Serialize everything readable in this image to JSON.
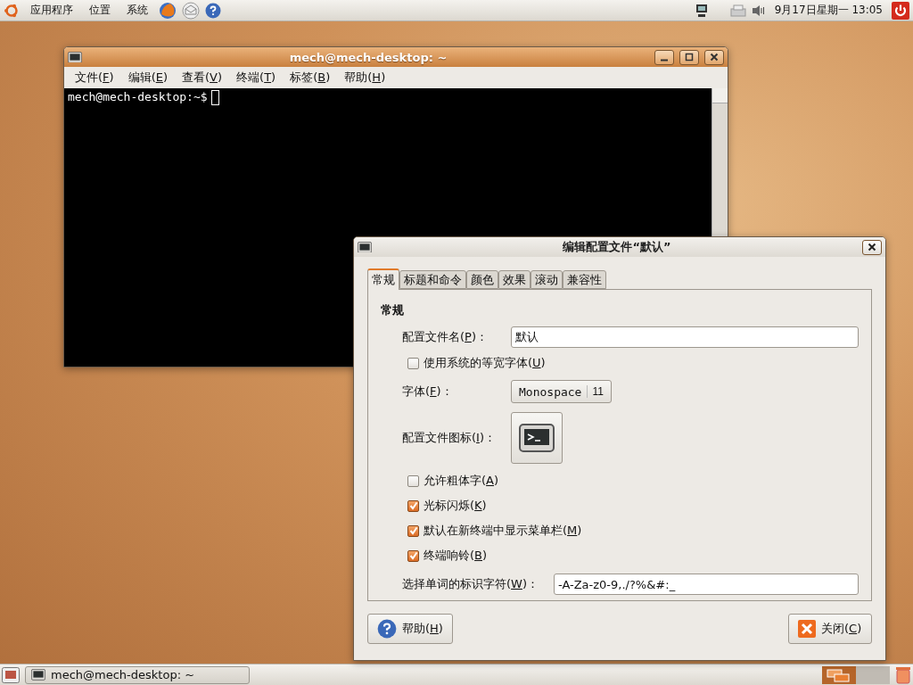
{
  "top_panel": {
    "menus": [
      "应用程序",
      "位置",
      "系统"
    ],
    "clock": "9月17日星期一 13:05"
  },
  "terminal": {
    "title": "mech@mech-desktop: ~",
    "menus": [
      "文件(F)",
      "编辑(E)",
      "查看(V)",
      "终端(T)",
      "标签(B)",
      "帮助(H)"
    ],
    "prompt": "mech@mech-desktop:~$"
  },
  "dialog": {
    "title": "编辑配置文件“默认”",
    "tabs": [
      {
        "label": "常规",
        "selected": true
      },
      {
        "label": "标题和命令",
        "selected": false
      },
      {
        "label": "颜色",
        "selected": false
      },
      {
        "label": "效果",
        "selected": false
      },
      {
        "label": "滚动",
        "selected": false
      },
      {
        "label": "兼容性",
        "selected": false
      }
    ],
    "section": "常规",
    "rows": [
      {
        "kind": "text",
        "label": "配置文件名(P)：",
        "value": "默认"
      },
      {
        "kind": "checkbox",
        "label": "使用系统的等宽字体(U)",
        "checked": false
      },
      {
        "kind": "font",
        "label": "字体(F)：",
        "value": "Monospace",
        "size": "11"
      },
      {
        "kind": "icon",
        "label": "配置文件图标(I)："
      },
      {
        "kind": "checkbox",
        "label": "允许粗体字(A)",
        "checked": false
      },
      {
        "kind": "checkbox",
        "label": "光标闪烁(K)",
        "checked": true
      },
      {
        "kind": "checkbox",
        "label": "默认在新终端中显示菜单栏(M)",
        "checked": true
      },
      {
        "kind": "checkbox",
        "label": "终端响铃(B)",
        "checked": true
      },
      {
        "kind": "text",
        "label": "选择单词的标识字符(W)：",
        "value": "-A-Za-z0-9,./?%&#:_"
      }
    ],
    "buttons": [
      {
        "kind": "help",
        "label": "帮助(H)"
      },
      {
        "kind": "close",
        "label": "关闭(C)"
      }
    ]
  },
  "taskbar": {
    "items": [
      "mech@mech-desktop: ~"
    ]
  }
}
